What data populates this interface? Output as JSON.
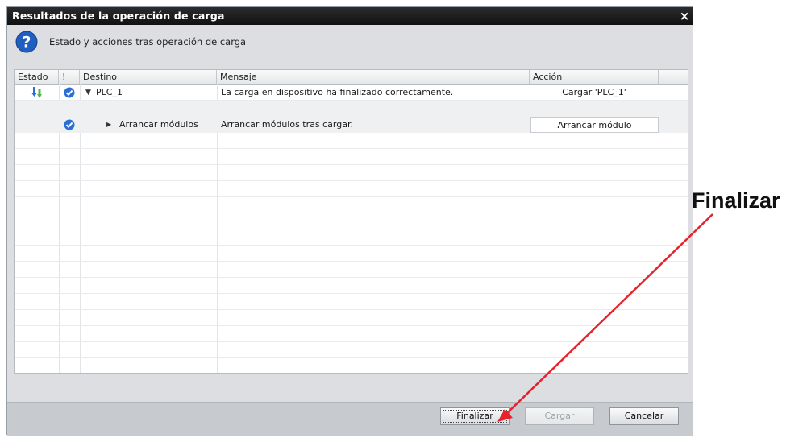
{
  "dialog": {
    "title": "Resultados de la operación de carga",
    "close_glyph": "×",
    "header_text": "Estado y acciones tras operación de carga",
    "help_icon": "question-mark-icon"
  },
  "table": {
    "columns": [
      "Estado",
      "!",
      "Destino",
      "Mensaje",
      "Acción"
    ],
    "rows": [
      {
        "estado_icon": "download-icon",
        "check_icon": "check-circle-icon",
        "expand": "collapse",
        "destino": "PLC_1",
        "mensaje": "La carga en dispositivo ha finalizado correctamente.",
        "accion": "Cargar 'PLC_1'"
      },
      {
        "estado_icon": "",
        "check_icon": "check-circle-icon",
        "expand": "expand",
        "destino": "Arrancar módulos",
        "mensaje": "Arrancar módulos tras cargar.",
        "accion": "Arrancar módulo"
      }
    ]
  },
  "buttons": {
    "finish": "Finalizar",
    "load": "Cargar",
    "cancel": "Cancelar"
  },
  "annotation": {
    "label": "Finalizar"
  },
  "colors": {
    "arrow": "#e8222b",
    "check": "#2a6fd6",
    "help": "#1f5fbf",
    "download_top": "#2a6fd6",
    "download_arrow": "#5bb44a"
  }
}
